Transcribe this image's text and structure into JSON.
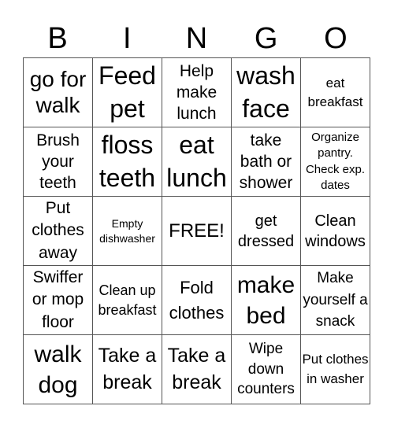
{
  "header": {
    "letters": [
      "B",
      "I",
      "N",
      "G",
      "O"
    ]
  },
  "grid": {
    "cells": [
      "go for walk",
      "Feed pet",
      "Help make lunch",
      "wash face",
      "eat breakfast",
      "Brush your teeth",
      "floss teeth",
      "eat lunch",
      "take bath or shower",
      "Organize pantry. Check exp. dates",
      "Put clothes away",
      "Empty dishwasher",
      "FREE!",
      "get dressed",
      "Clean windows",
      "Swiffer or mop floor",
      "Clean up breakfast",
      "Fold clothes",
      "make bed",
      "Make yourself a snack",
      "walk dog",
      "Take a break",
      "Take a break",
      "Wipe down counters",
      "Put clothes in washer"
    ]
  }
}
